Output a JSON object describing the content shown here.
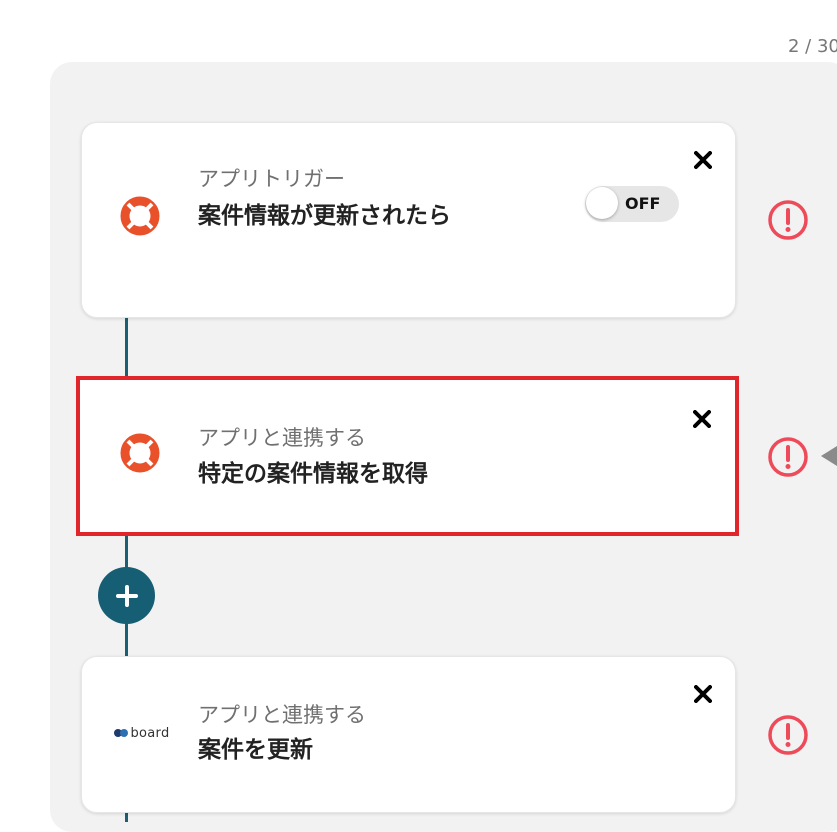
{
  "step_counter": "2 / 30",
  "cards": [
    {
      "type_label": "アプリトリガー",
      "title": "案件情報が更新されたら",
      "toggle_label": "OFF",
      "icon": "lifebuoy-icon"
    },
    {
      "type_label": "アプリと連携する",
      "title": "特定の案件情報を取得",
      "icon": "lifebuoy-icon"
    },
    {
      "type_label": "アプリと連携する",
      "title": "案件を更新",
      "icon": "board-logo-icon",
      "logo_text": "board"
    }
  ],
  "colors": {
    "accent": "#155e73",
    "warning": "#ee4b5a",
    "selected_border": "#e0262b",
    "app_icon": "#e8512a"
  }
}
